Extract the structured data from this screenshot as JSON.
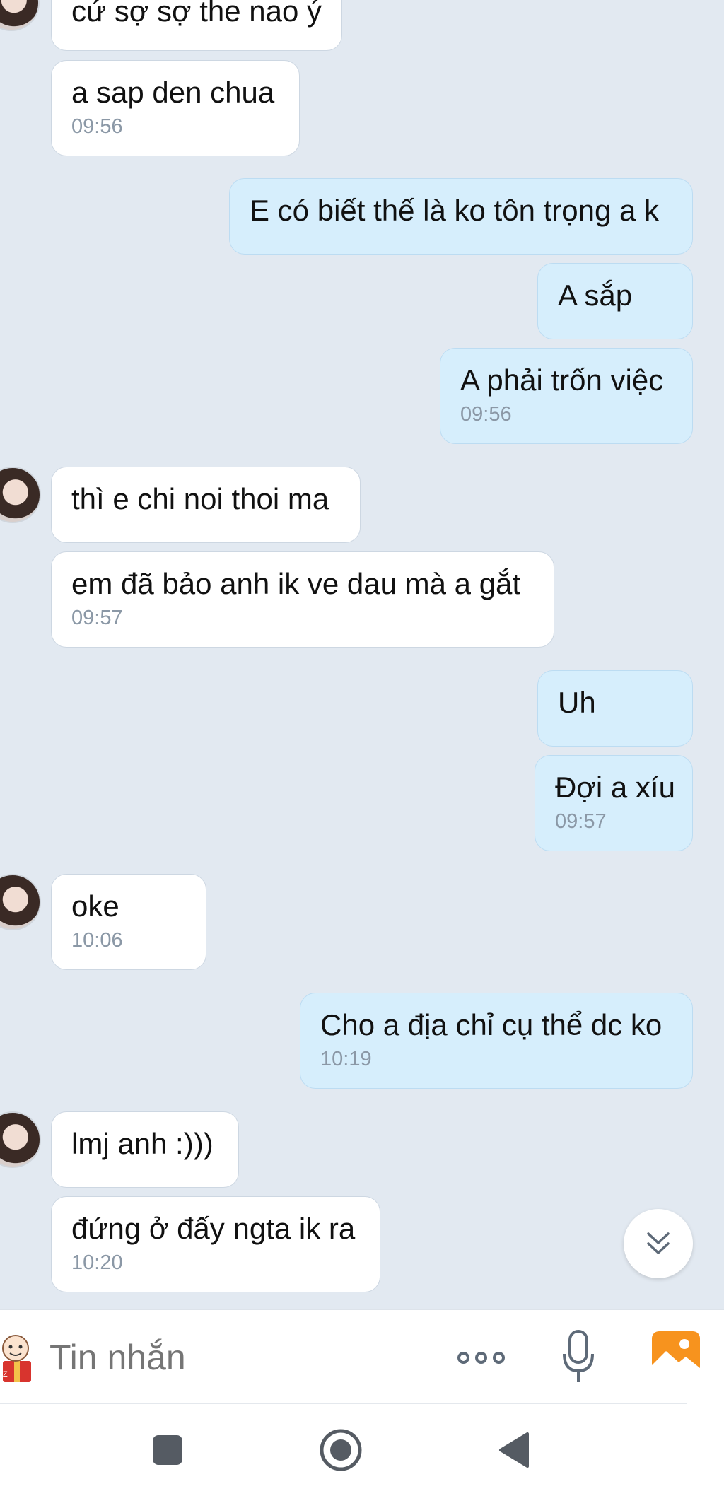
{
  "messages": [
    {
      "text": "cứ sợ sợ the nao ý",
      "time": ""
    },
    {
      "text": "a sap den chua",
      "time": "09:56"
    },
    {
      "text": "E có biết thế là ko tôn trọng a k",
      "time": ""
    },
    {
      "text": "A sắp",
      "time": ""
    },
    {
      "text": "A phải trốn việc",
      "time": "09:56"
    },
    {
      "text": "thì e chi noi thoi ma",
      "time": ""
    },
    {
      "text": "em đã bảo anh ik ve dau mà a gắt",
      "time": "09:57"
    },
    {
      "text": "Uh",
      "time": ""
    },
    {
      "text": "Đợi a xíu",
      "time": "09:57"
    },
    {
      "text": "oke",
      "time": "10:06"
    },
    {
      "text": "Cho a địa chỉ cụ thể dc ko",
      "time": "10:19"
    },
    {
      "text": "lmj anh :)))",
      "time": ""
    },
    {
      "text": "đứng ở đấy ngta ik ra",
      "time": "10:20"
    }
  ],
  "composer": {
    "placeholder": "Tin nhắn",
    "sticker_icon": "sticker-icon",
    "more_icon": "more-options-icon",
    "mic_icon": "microphone-icon",
    "photo_icon": "photo-gallery-icon",
    "photo_color": "#f7931e"
  },
  "scroll_button_icon": "chevron-double-down-icon",
  "navigation": {
    "recent_icon": "recent-apps-icon",
    "home_icon": "home-icon",
    "back_icon": "back-icon"
  },
  "colors": {
    "background": "#e2e9f1",
    "incoming_bubble": "#ffffff",
    "outgoing_bubble": "#d6eefc",
    "timestamp": "#8b98a6"
  }
}
